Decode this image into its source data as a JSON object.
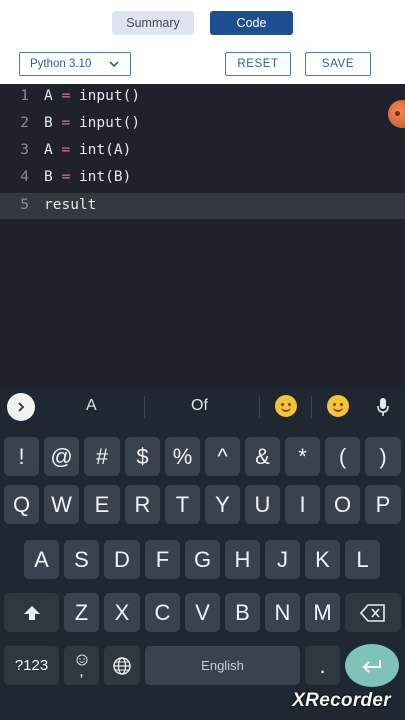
{
  "header": {
    "tabs": [
      {
        "label": "Summary",
        "active": false
      },
      {
        "label": "Code",
        "active": true
      }
    ],
    "language_select": {
      "value": "Python 3.10"
    },
    "reset_label": "RESET",
    "save_label": "SAVE"
  },
  "editor": {
    "lines": [
      {
        "num": "1",
        "var": "A",
        "op": "=",
        "expr": "input()"
      },
      {
        "num": "2",
        "var": "B",
        "op": "=",
        "expr": "input()"
      },
      {
        "num": "3",
        "var": "A",
        "op": "=",
        "expr": "int(A)"
      },
      {
        "num": "4",
        "var": "B",
        "op": "=",
        "expr": "int(B)"
      },
      {
        "num": "5",
        "text": "result",
        "active": true
      }
    ]
  },
  "keyboard": {
    "suggestions": [
      "A",
      "Of"
    ],
    "symbols_row": [
      "!",
      "@",
      "#",
      "$",
      "%",
      "^",
      "&",
      "*",
      "(",
      ")"
    ],
    "row1": [
      "Q",
      "W",
      "E",
      "R",
      "T",
      "Y",
      "U",
      "I",
      "O",
      "P"
    ],
    "row2": [
      "A",
      "S",
      "D",
      "F",
      "G",
      "H",
      "J",
      "K",
      "L"
    ],
    "row3": [
      "Z",
      "X",
      "C",
      "V",
      "B",
      "N",
      "M"
    ],
    "symbols_key": "?123",
    "comma_key": ",",
    "period_key": ".",
    "space_label": "English",
    "colors": {
      "enter": "#7fc3b8",
      "key": "#3a434d",
      "background": "#1f2730"
    }
  },
  "watermark": "XRecorder"
}
